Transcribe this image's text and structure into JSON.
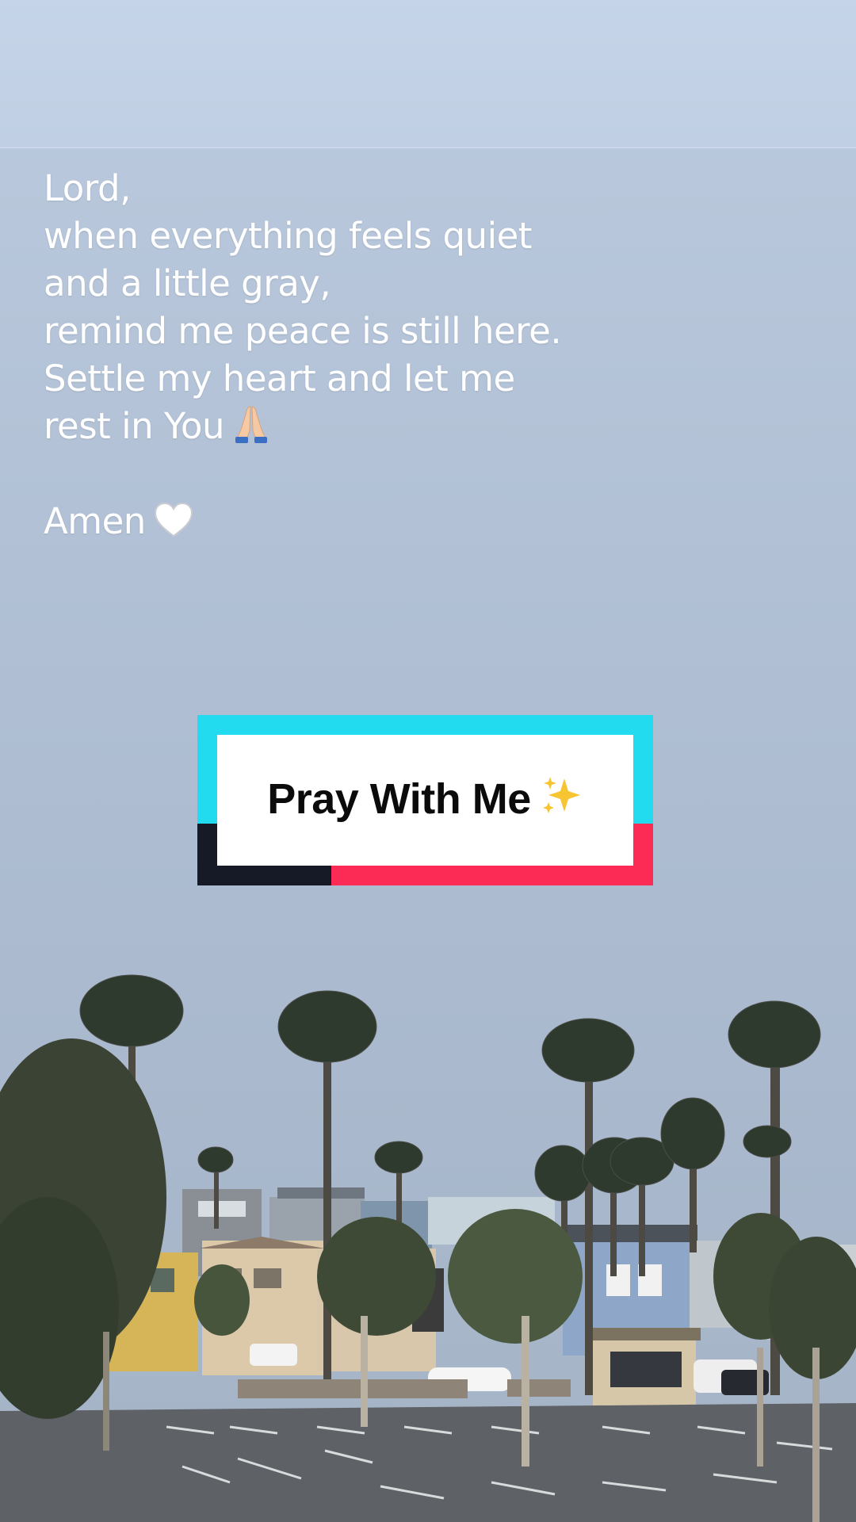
{
  "caption": {
    "lines": [
      "Lord,",
      "when everything feels quiet",
      "and a little gray,",
      "remind me peace is still here.",
      "Settle my heart and let me",
      "rest in You"
    ],
    "closing": "Amen"
  },
  "title_card": {
    "text": "Pray With Me"
  },
  "icons": {
    "after_rest_line": "praying-hands-icon",
    "after_amen": "white-heart-icon",
    "after_title": "sparkles-icon"
  },
  "colors": {
    "sky": "#b3c2d6",
    "caption_text": "#ffffff",
    "card_cyan": "#22dbef",
    "card_pink": "#fb2b55",
    "card_dark": "#161a26",
    "card_inner": "#ffffff",
    "title_text": "#0b0b0b"
  }
}
